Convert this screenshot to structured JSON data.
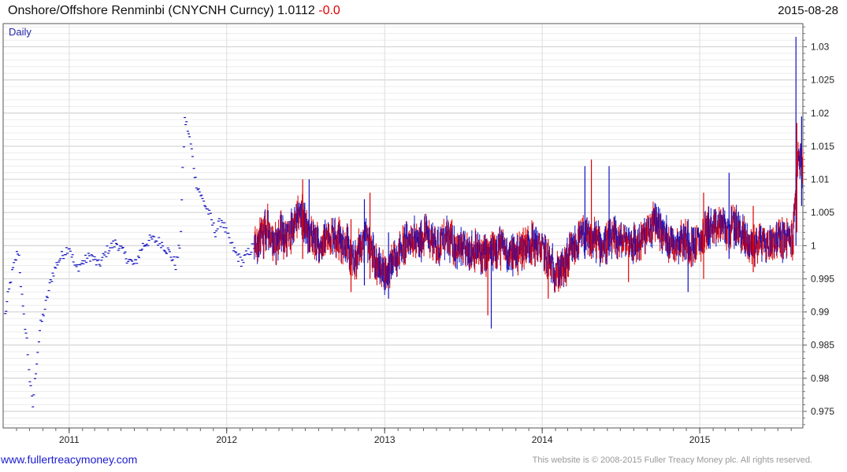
{
  "header": {
    "title": "Onshore/Offshore Renminbi (CNYCNH Curncy) 1.0112",
    "change": "-0.0",
    "date": "2015-08-28"
  },
  "footer": {
    "link": "www.fullertreacymoney.com",
    "copyright": "This website is © 2008-2015 Fuller Treacy Money plc. All rights reserved."
  },
  "colors": {
    "series_up": "#e00000",
    "series_down": "#1010c0",
    "grid": "#dcdcdc",
    "frame": "#555555"
  },
  "chart_data": {
    "type": "line",
    "periodicity_label": "Daily",
    "x_range": [
      "2010-08-01",
      "2015-08-28"
    ],
    "x_ticks": [
      "2011",
      "2012",
      "2013",
      "2014",
      "2015"
    ],
    "ylim": [
      0.9725,
      1.0335
    ],
    "y_ticks": [
      0.975,
      0.98,
      0.985,
      0.99,
      0.995,
      1,
      1.005,
      1.01,
      1.015,
      1.02,
      1.025,
      1.03
    ],
    "y_tick_labels": [
      "0.975",
      "0.98",
      "0.985",
      "0.99",
      "0.995",
      "1",
      "1.005",
      "1.01",
      "1.015",
      "1.02",
      "1.025",
      "1.03"
    ],
    "grid": true,
    "y_axis_side": "right",
    "last_value": 1.0112,
    "series": [
      {
        "style": "daily-ticks",
        "points": [
          [
            "2010-08-05",
            0.9895
          ],
          [
            "2010-08-20",
            0.9955
          ],
          [
            "2010-09-05",
            0.9995
          ],
          [
            "2010-09-15",
            0.9905
          ],
          [
            "2010-09-25",
            0.9855
          ],
          [
            "2010-10-01",
            0.98
          ],
          [
            "2010-10-08",
            0.9755
          ],
          [
            "2010-10-15",
            0.981
          ],
          [
            "2010-10-25",
            0.9875
          ],
          [
            "2010-11-05",
            0.9905
          ],
          [
            "2010-11-12",
            0.9925
          ],
          [
            "2010-11-22",
            0.9955
          ],
          [
            "2010-12-05",
            0.9975
          ],
          [
            "2010-12-15",
            0.9985
          ],
          [
            "2011-01-01",
            1.0
          ],
          [
            "2011-01-15",
            0.9965
          ],
          [
            "2011-02-01",
            0.9975
          ],
          [
            "2011-02-20",
            0.9985
          ],
          [
            "2011-03-10",
            0.997
          ],
          [
            "2011-04-01",
            0.9995
          ],
          [
            "2011-04-20",
            1.0005
          ],
          [
            "2011-05-10",
            0.9985
          ],
          [
            "2011-06-01",
            0.997
          ],
          [
            "2011-06-20",
            1.0
          ],
          [
            "2011-07-10",
            1.001
          ],
          [
            "2011-08-01",
            1.0005
          ],
          [
            "2011-08-20",
            0.999
          ],
          [
            "2011-09-05",
            0.997
          ],
          [
            "2011-09-15",
            1.0005
          ],
          [
            "2011-09-25",
            1.019
          ],
          [
            "2011-10-01",
            1.018
          ],
          [
            "2011-10-10",
            1.015
          ],
          [
            "2011-10-20",
            1.01
          ],
          [
            "2011-11-05",
            1.007
          ],
          [
            "2011-11-20",
            1.005
          ],
          [
            "2011-12-05",
            1.002
          ],
          [
            "2011-12-20",
            1.004
          ],
          [
            "2012-01-05",
            1.001
          ],
          [
            "2012-01-20",
            0.999
          ],
          [
            "2012-02-05",
            0.9975
          ],
          [
            "2012-02-20",
            0.999
          ],
          [
            "2012-03-05",
            1.0
          ]
        ]
      },
      {
        "style": "ohlc-dense",
        "points": [
          [
            "2012-03-05",
            1.0
          ],
          [
            "2012-03-20",
            1.001
          ],
          [
            "2012-04-05",
            1.003
          ],
          [
            "2012-04-20",
            1.0
          ],
          [
            "2012-05-05",
            1.002
          ],
          [
            "2012-05-20",
            1.001
          ],
          [
            "2012-06-05",
            1.003
          ],
          [
            "2012-06-20",
            1.005
          ],
          [
            "2012-07-05",
            1.002
          ],
          [
            "2012-07-20",
            1.001
          ],
          [
            "2012-08-05",
            1.0
          ],
          [
            "2012-08-20",
            1.001
          ],
          [
            "2012-09-05",
            1.002
          ],
          [
            "2012-09-20",
            1.001
          ],
          [
            "2012-10-05",
            1.0
          ],
          [
            "2012-10-20",
            0.997
          ],
          [
            "2012-11-05",
            1.0
          ],
          [
            "2012-11-20",
            1.001
          ],
          [
            "2012-12-05",
            0.9985
          ],
          [
            "2012-12-20",
            0.9965
          ],
          [
            "2013-01-05",
            0.996
          ],
          [
            "2013-01-20",
            0.9975
          ],
          [
            "2013-02-05",
            0.9995
          ],
          [
            "2013-02-20",
            1.0005
          ],
          [
            "2013-03-05",
            1.0015
          ],
          [
            "2013-03-20",
            1.0
          ],
          [
            "2013-04-05",
            1.002
          ],
          [
            "2013-04-20",
            1.001
          ],
          [
            "2013-05-05",
            1.0
          ],
          [
            "2013-05-20",
            1.001
          ],
          [
            "2013-06-05",
            1.0005
          ],
          [
            "2013-06-20",
            0.9995
          ],
          [
            "2013-07-05",
            0.999
          ],
          [
            "2013-07-20",
            0.9995
          ],
          [
            "2013-08-05",
            0.999
          ],
          [
            "2013-08-20",
            0.9985
          ],
          [
            "2013-09-05",
            0.999
          ],
          [
            "2013-09-20",
            1.0
          ],
          [
            "2013-10-05",
            0.9995
          ],
          [
            "2013-10-20",
            0.9985
          ],
          [
            "2013-11-05",
            0.999
          ],
          [
            "2013-11-20",
            1.0
          ],
          [
            "2013-12-05",
            1.0005
          ],
          [
            "2013-12-20",
            1.0
          ],
          [
            "2014-01-05",
            0.999
          ],
          [
            "2014-01-20",
            0.997
          ],
          [
            "2014-02-05",
            0.996
          ],
          [
            "2014-02-20",
            0.9965
          ],
          [
            "2014-03-05",
            0.9985
          ],
          [
            "2014-03-20",
            1.0
          ],
          [
            "2014-04-05",
            1.0015
          ],
          [
            "2014-04-20",
            1.0005
          ],
          [
            "2014-05-05",
            1.001
          ],
          [
            "2014-05-20",
            1.0
          ],
          [
            "2014-06-05",
            1.0005
          ],
          [
            "2014-06-20",
            1.001
          ],
          [
            "2014-07-05",
            1.0005
          ],
          [
            "2014-07-20",
            1.001
          ],
          [
            "2014-08-05",
            1.0
          ],
          [
            "2014-08-20",
            1.001
          ],
          [
            "2014-09-05",
            1.002
          ],
          [
            "2014-09-20",
            1.004
          ],
          [
            "2014-10-05",
            1.002
          ],
          [
            "2014-10-20",
            1.001
          ],
          [
            "2014-11-05",
            1.0005
          ],
          [
            "2014-11-20",
            1.001
          ],
          [
            "2014-12-05",
            1.0005
          ],
          [
            "2014-12-20",
            1.0
          ],
          [
            "2015-01-05",
            1.001
          ],
          [
            "2015-01-20",
            1.003
          ],
          [
            "2015-02-05",
            1.002
          ],
          [
            "2015-02-20",
            1.0035
          ],
          [
            "2015-03-05",
            1.002
          ],
          [
            "2015-03-20",
            1.003
          ],
          [
            "2015-04-05",
            1.002
          ],
          [
            "2015-04-20",
            1.0005
          ],
          [
            "2015-05-05",
            1.0
          ],
          [
            "2015-05-20",
            1.001
          ],
          [
            "2015-06-05",
            1.0
          ],
          [
            "2015-06-20",
            1.001
          ],
          [
            "2015-07-05",
            1.001
          ],
          [
            "2015-07-20",
            1.001
          ],
          [
            "2015-08-05",
            1.001
          ],
          [
            "2015-08-12",
            1.01
          ],
          [
            "2015-08-18",
            1.014
          ],
          [
            "2015-08-24",
            1.012
          ],
          [
            "2015-08-28",
            1.0112
          ]
        ]
      }
    ],
    "spikes": [
      [
        "2012-06-25",
        1.01,
        0.998
      ],
      [
        "2012-07-10",
        1.01,
        0.999
      ],
      [
        "2012-10-15",
        1.004,
        0.993
      ],
      [
        "2012-11-15",
        1.007,
        0.994
      ],
      [
        "2012-11-28",
        1.008,
        0.995
      ],
      [
        "2013-01-10",
        1.002,
        0.992
      ],
      [
        "2013-08-28",
        1.0,
        0.9895
      ],
      [
        "2013-09-05",
        1.0,
        0.9875
      ],
      [
        "2014-01-15",
        1.001,
        0.992
      ],
      [
        "2014-04-10",
        1.012,
        0.998
      ],
      [
        "2014-04-25",
        1.013,
        0.998
      ],
      [
        "2014-06-05",
        1.012,
        0.9985
      ],
      [
        "2014-07-20",
        1.0,
        0.9945
      ],
      [
        "2014-12-05",
        1.004,
        0.993
      ],
      [
        "2015-01-10",
        1.008,
        0.995
      ],
      [
        "2015-03-10",
        1.011,
        0.998
      ],
      [
        "2015-05-05",
        1.006,
        0.996
      ],
      [
        "2015-08-12",
        1.0315,
        1.0
      ],
      [
        "2015-08-14",
        1.0185,
        1.002
      ],
      [
        "2015-08-25",
        1.0195,
        1.006
      ]
    ]
  }
}
